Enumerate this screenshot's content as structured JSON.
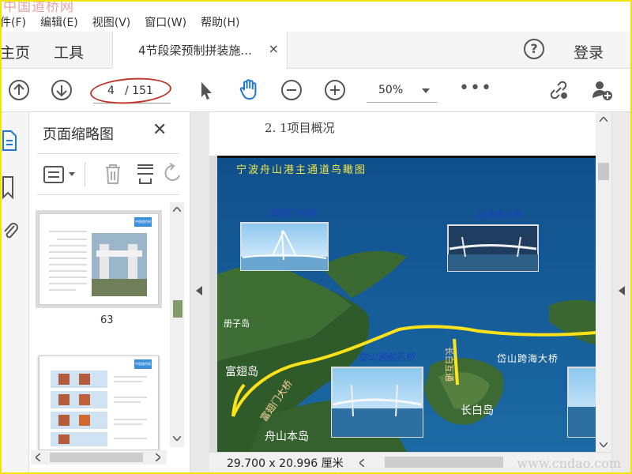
{
  "watermark": {
    "top": "中国道桥网",
    "bottom": "www.cndao.com"
  },
  "menu": [
    "件(F)",
    "编辑(E)",
    "视图(V)",
    "窗口(W)",
    "帮助(H)"
  ],
  "tabs": {
    "home": "主页",
    "tools": "工具",
    "document": "4节段梁预制拼装施...",
    "close": "×",
    "help": "?",
    "login": "登录"
  },
  "toolbar": {
    "page_current": "4",
    "page_total": "/ 151",
    "zoom": "50%",
    "more": "•••"
  },
  "thumbnails": {
    "title": "页面缩略图",
    "close": "✕",
    "pages": [
      {
        "label": "63",
        "badge": "中国道桥网"
      },
      {
        "label": "",
        "badge": "中国道桥网"
      }
    ]
  },
  "page": {
    "heading": "2. 1项目概况",
    "map_title": "宁波舟山港主通道鸟瞰图",
    "bridge_labels": [
      "富翅门大桥",
      "主通道大桥",
      "岱山通航孔桥"
    ],
    "place_labels": [
      "册子岛",
      "富翅岛",
      "富翅门大桥",
      "舟山本岛",
      "长白岛",
      "长白互通",
      "岱山跨海大桥"
    ]
  },
  "status": {
    "dimensions": "29.700 x 20.996 厘米"
  },
  "colors": {
    "route": "#ffe21a",
    "sea": "#1a4f8a",
    "accent_frame": "#f2e600",
    "oval": "#c0392b"
  }
}
